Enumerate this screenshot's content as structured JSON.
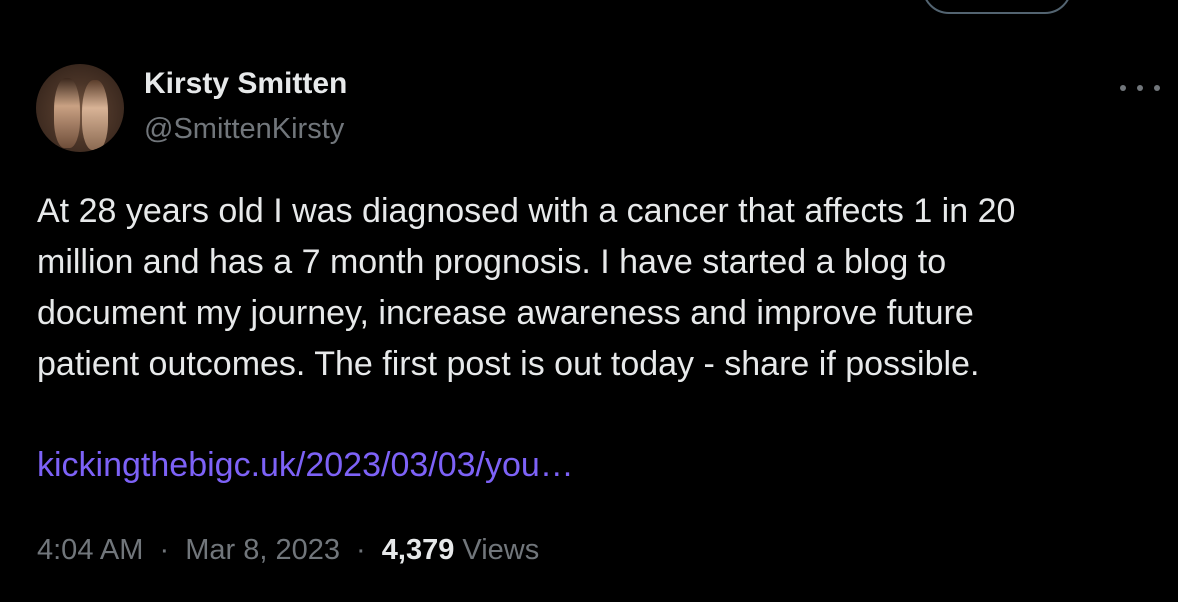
{
  "tweet": {
    "author": {
      "display_name": "Kirsty Smitten",
      "handle": "@SmittenKirsty",
      "avatar_icon": "profile-photo"
    },
    "more_icon": "ellipsis-icon",
    "text_lines": [
      "At 28 years old I was diagnosed with a cancer that affects 1 in 20",
      "million and has a 7 month prognosis. I have started a blog to",
      "document my journey, increase awareness and improve future",
      "patient outcomes. The first post is out today - share if possible."
    ],
    "link": "kickingthebigc.uk/2023/03/03/you…",
    "time": "4:04 AM",
    "separator": "·",
    "date": "Mar 8, 2023",
    "views_count": "4,379",
    "views_label": "Views"
  },
  "colors": {
    "background": "#000000",
    "primary_text": "#e7e9ea",
    "secondary_text": "#71767b",
    "link": "#7d62f7"
  }
}
